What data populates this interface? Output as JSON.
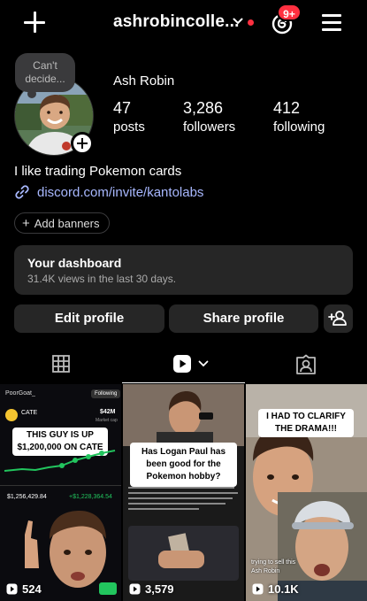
{
  "header": {
    "username": "ashrobincolle...",
    "notification_count": "9+"
  },
  "profile": {
    "note": "Can't decide...",
    "display_name": "Ash Robin",
    "stats": [
      {
        "value": "47",
        "label": "posts"
      },
      {
        "value": "3,286",
        "label": "followers"
      },
      {
        "value": "412",
        "label": "following"
      }
    ],
    "bio": "I like trading Pokemon cards",
    "link": "discord.com/invite/kantolabs",
    "add_banners": "Add banners"
  },
  "dashboard": {
    "title": "Your dashboard",
    "subtitle": "31.4K views in the last 30 days."
  },
  "actions": {
    "edit": "Edit profile",
    "share": "Share profile"
  },
  "tabs": [
    "grid-icon",
    "reels-icon",
    "tagged-icon"
  ],
  "posts": [
    {
      "caption": "THIS GUY IS UP $1,200,000 ON CATE",
      "views": "524",
      "account": "PoorGoat_",
      "follow": "Following",
      "token": "CATE",
      "mcap": "$42M",
      "mcap_label": "Market cap",
      "balance": "$1,256,429.84",
      "change": "+$1,228,364.54"
    },
    {
      "caption": "Has Logan Paul has been good for the Pokemon hobby?",
      "views": "3,579"
    },
    {
      "caption": "I HAD TO CLARIFY THE DRAMA!!!",
      "views": "10.1K",
      "subtitle": "trying to sell this",
      "author": "Ash Robin"
    }
  ],
  "colors": {
    "background": "#000000",
    "surface": "#262626",
    "link": "#a8b8ff",
    "badge": "#ff3040",
    "status_dot": "#ff3040",
    "green": "#22c55e"
  }
}
